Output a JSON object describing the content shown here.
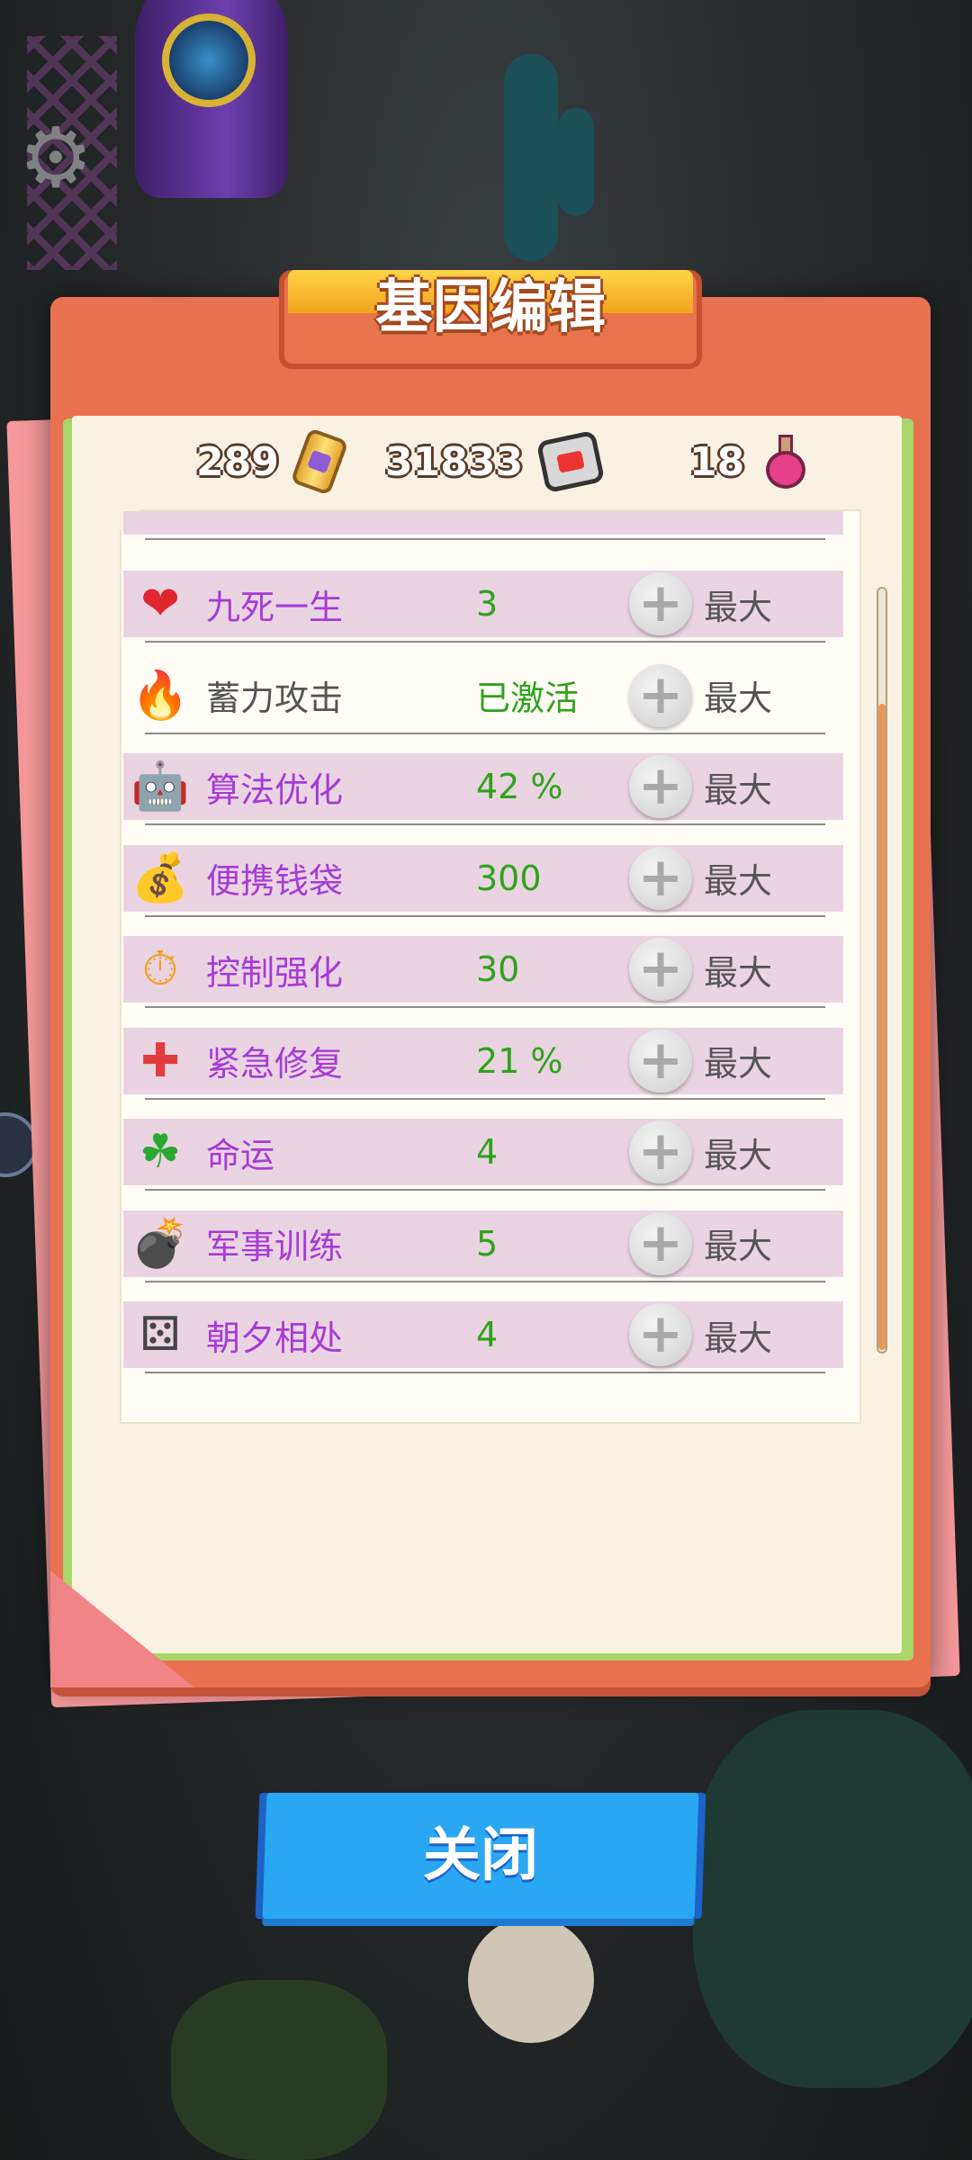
{
  "title": "基因编辑",
  "currency": [
    {
      "value": "289",
      "icon": "battery-icon"
    },
    {
      "value": "31833",
      "icon": "chip-icon"
    },
    {
      "value": "18",
      "icon": "potion-icon"
    }
  ],
  "genes": [
    {
      "name": "九死一生",
      "value": "3",
      "max": "最大",
      "icon": "infinity-heart-icon",
      "name_color": "purple",
      "highlight": true
    },
    {
      "name": "蓄力攻击",
      "value": "已激活",
      "max": "最大",
      "icon": "power-strike-icon",
      "name_color": "gray",
      "highlight": false
    },
    {
      "name": "算法优化",
      "value": "42 %",
      "max": "最大",
      "icon": "robot-icon",
      "name_color": "purple",
      "highlight": true
    },
    {
      "name": "便携钱袋",
      "value": "300",
      "max": "最大",
      "icon": "money-bag-icon",
      "name_color": "purple",
      "highlight": true
    },
    {
      "name": "控制强化",
      "value": "30",
      "max": "最大",
      "icon": "stopwatch-icon",
      "name_color": "purple",
      "highlight": true
    },
    {
      "name": "紧急修复",
      "value": "21 %",
      "max": "最大",
      "icon": "first-aid-kit-icon",
      "name_color": "purple",
      "highlight": true
    },
    {
      "name": "命运",
      "value": "4",
      "max": "最大",
      "icon": "four-leaf-clover-icon",
      "name_color": "purple",
      "highlight": true
    },
    {
      "name": "军事训练",
      "value": "5",
      "max": "最大",
      "icon": "soldier-bomb-icon",
      "name_color": "purple",
      "highlight": true
    },
    {
      "name": "朝夕相处",
      "value": "4",
      "max": "最大",
      "icon": "dice-icon",
      "name_color": "purple",
      "highlight": true
    }
  ],
  "close_label": "关闭",
  "colors": {
    "accent": "#2aa7f2",
    "value_green": "#2fa31a",
    "name_purple": "#a63bd6",
    "row_highlight": "#ead4e2"
  }
}
